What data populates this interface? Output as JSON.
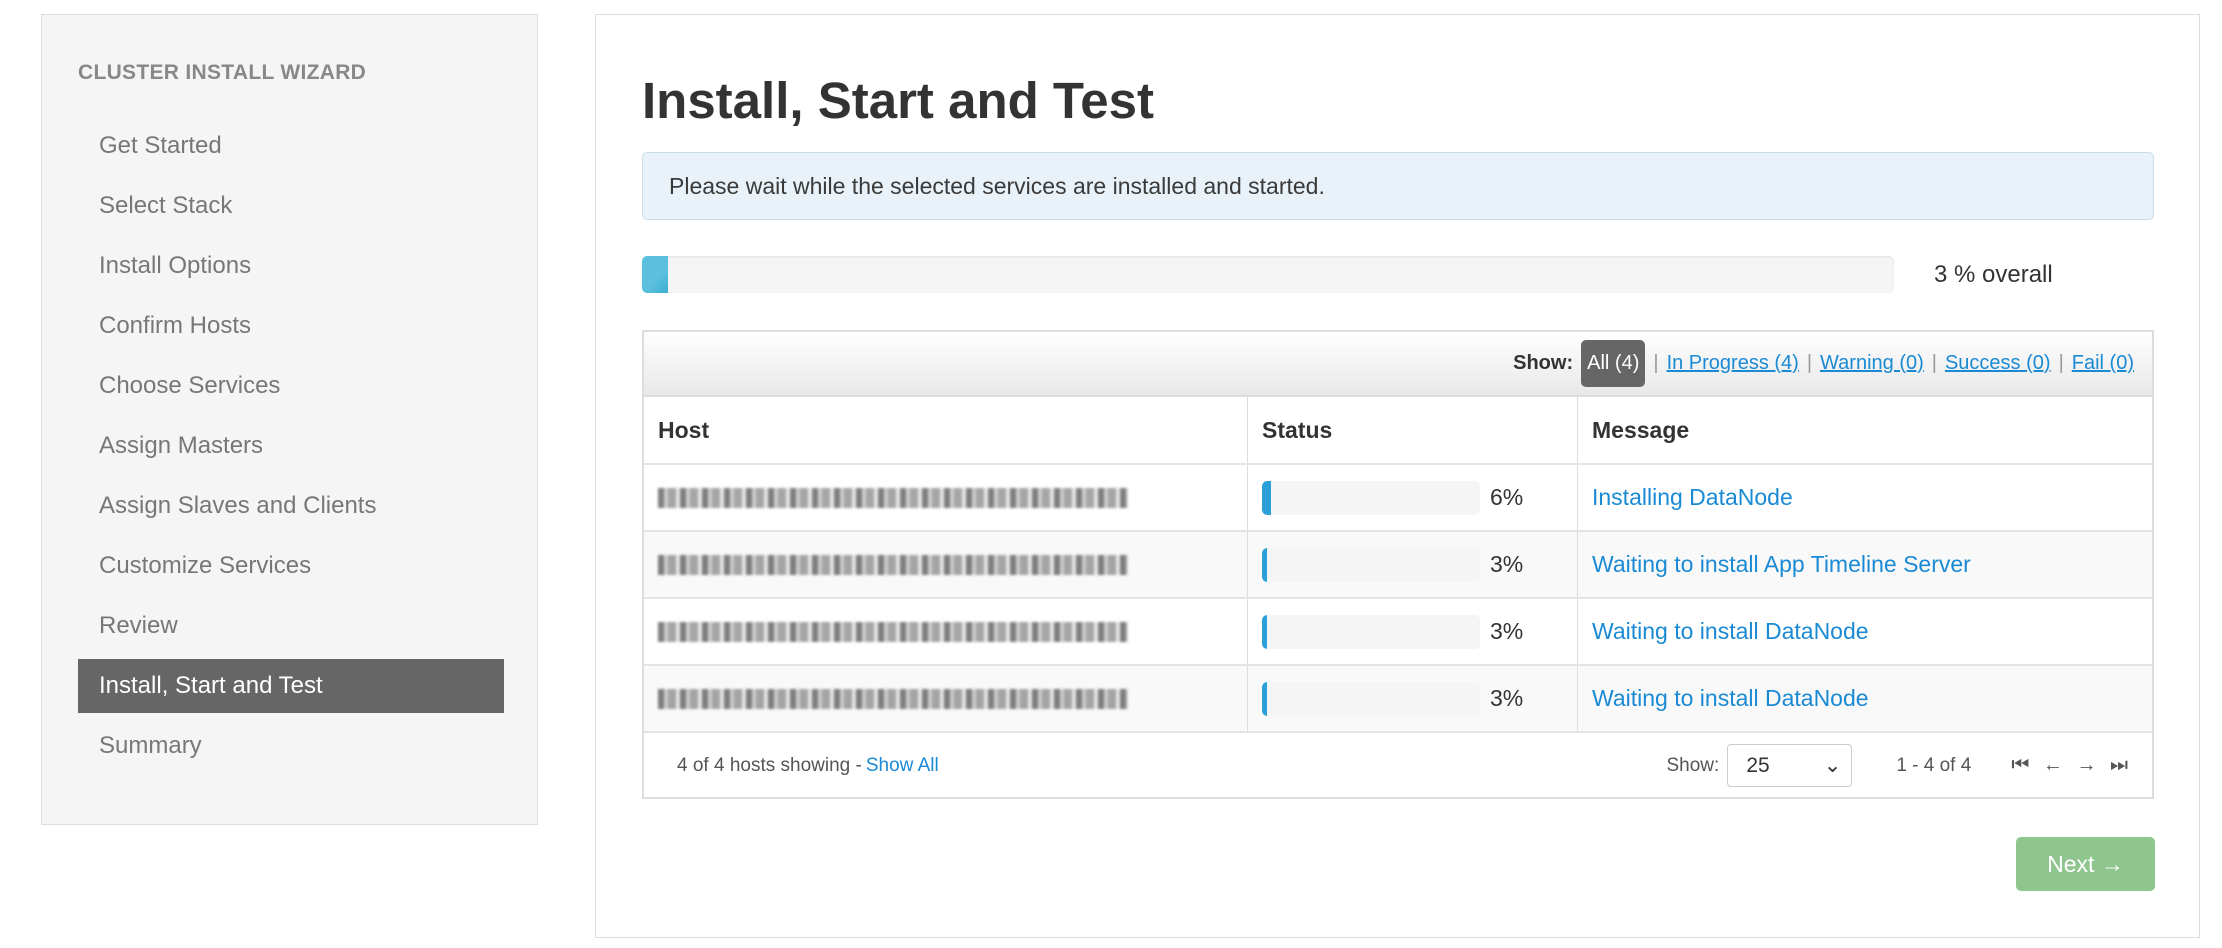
{
  "sidebar": {
    "title": "CLUSTER INSTALL WIZARD",
    "items": [
      {
        "label": "Get Started"
      },
      {
        "label": "Select Stack"
      },
      {
        "label": "Install Options"
      },
      {
        "label": "Confirm Hosts"
      },
      {
        "label": "Choose Services"
      },
      {
        "label": "Assign Masters"
      },
      {
        "label": "Assign Slaves and Clients"
      },
      {
        "label": "Customize Services"
      },
      {
        "label": "Review"
      },
      {
        "label": "Install, Start and Test",
        "active": true
      },
      {
        "label": "Summary"
      }
    ]
  },
  "main": {
    "title": "Install, Start and Test",
    "alert": "Please wait while the selected services are installed and started.",
    "overall_progress": 3,
    "overall_label": "3 % overall"
  },
  "filter": {
    "show_label": "Show:",
    "all": "All (4)",
    "in_progress": "In Progress (4)",
    "warning": "Warning (0)",
    "success": "Success (0)",
    "fail": "Fail (0)"
  },
  "table": {
    "headers": [
      "Host",
      "Status",
      "Message"
    ],
    "rows": [
      {
        "progress": 6,
        "pct": "6%",
        "message": "Installing DataNode"
      },
      {
        "progress": 3,
        "pct": "3%",
        "message": "Waiting to install App Timeline Server"
      },
      {
        "progress": 3,
        "pct": "3%",
        "message": "Waiting to install DataNode"
      },
      {
        "progress": 3,
        "pct": "3%",
        "message": "Waiting to install DataNode"
      }
    ]
  },
  "footer": {
    "hosts_showing": "4 of 4 hosts showing -",
    "show_all": "Show All",
    "show_label": "Show:",
    "page_size": "25",
    "range": "1 - 4 of 4"
  },
  "next_label": "Next →",
  "colors": {
    "accent": "#1a8ad4",
    "progress": "#5bc0de",
    "next": "#8fc58f",
    "active_nav": "#666666"
  }
}
